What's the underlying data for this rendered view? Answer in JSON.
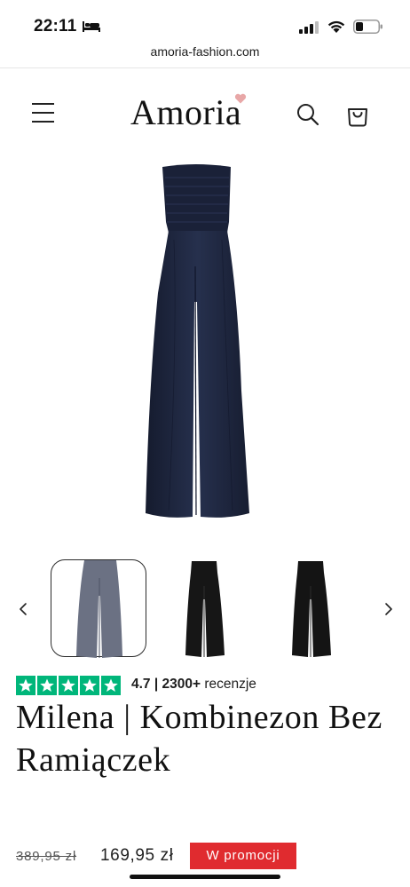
{
  "status_bar": {
    "time": "22:11",
    "icons": [
      "bed-icon",
      "cellular-signal-icon",
      "wifi-icon",
      "battery-icon"
    ]
  },
  "browser": {
    "url": "amoria-fashion.com"
  },
  "header": {
    "logo_text": "Amoria",
    "icons": [
      "menu-icon",
      "search-icon",
      "cart-icon"
    ],
    "heart_color": "#e8a7a7"
  },
  "product": {
    "rating": {
      "stars": 5,
      "score_text": "4.7 | 2300+",
      "reviews_label": "recenzje",
      "star_color": "#00b67a"
    },
    "title": "Milena | Kombinezon Bez Ramiączek",
    "old_price": "389,95 zł",
    "price": "169,95 zł",
    "sale_badge": "W promocji",
    "sale_color": "#e02b2f",
    "main_image_color": "#1f2740",
    "thumbnails": [
      {
        "color": "navy",
        "selected": true
      },
      {
        "color": "black",
        "selected": false
      },
      {
        "color": "black",
        "selected": false
      }
    ]
  }
}
